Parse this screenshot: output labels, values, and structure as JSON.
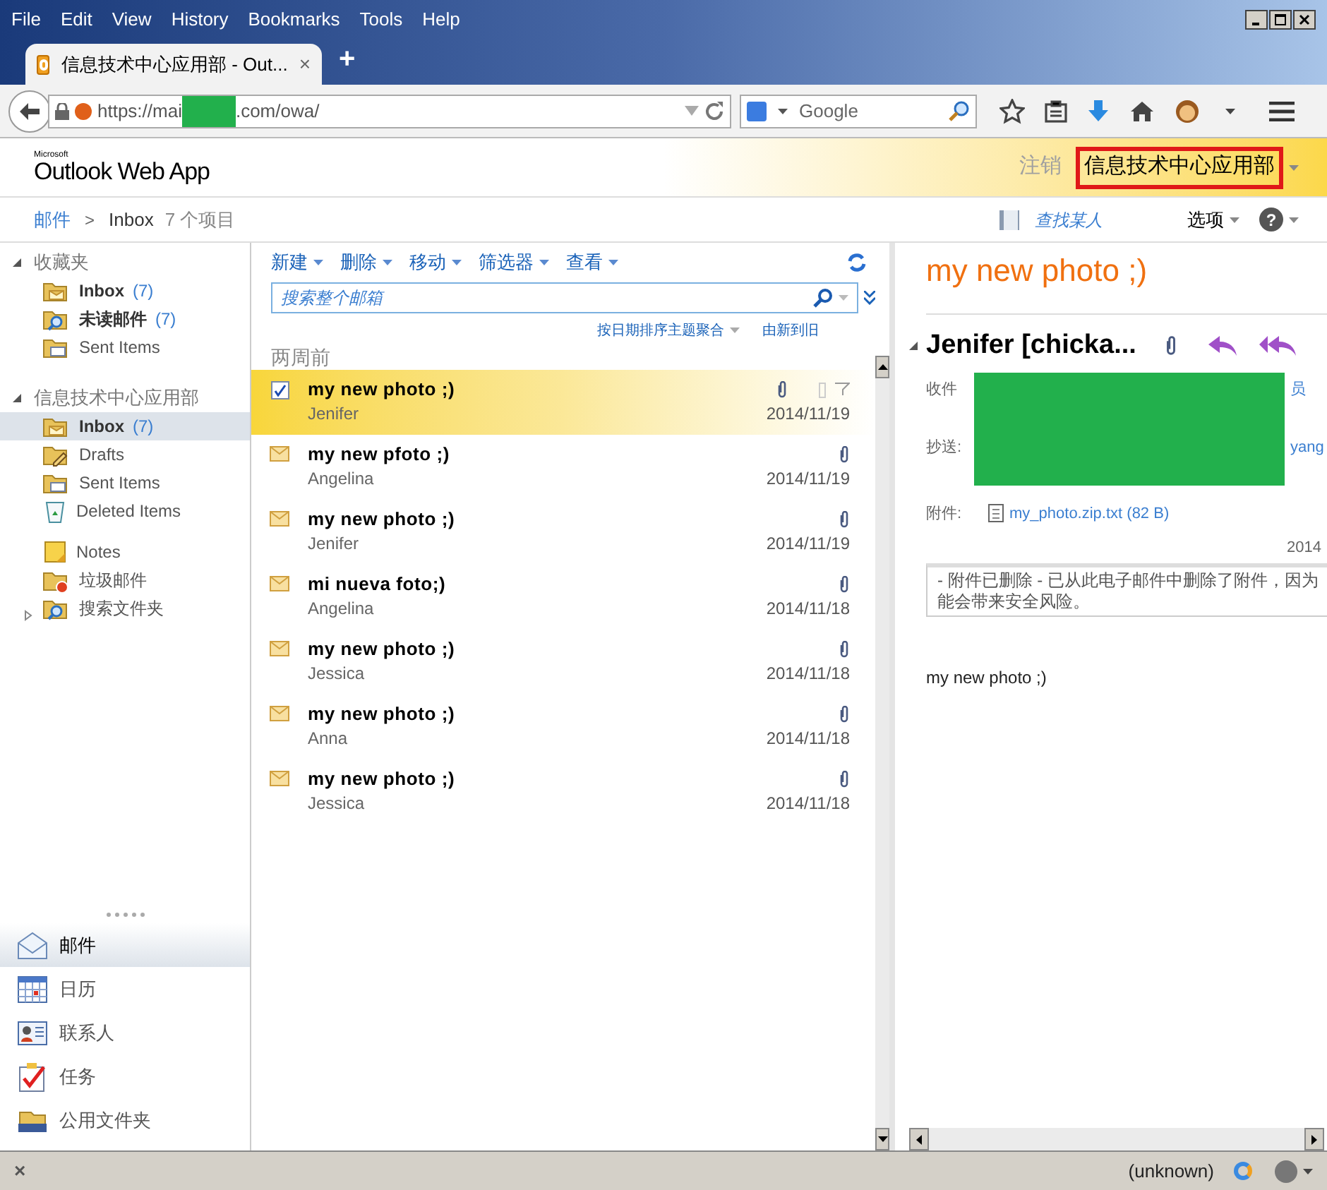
{
  "browser": {
    "menu": [
      "File",
      "Edit",
      "View",
      "History",
      "Bookmarks",
      "Tools",
      "Help"
    ],
    "tab": {
      "title": "信息技术中心应用部 - Out...",
      "close": "×"
    },
    "new_tab": "+",
    "url": {
      "prefix": "https://mai",
      "suffix": ".com/owa/"
    },
    "search": {
      "placeholder": "Google"
    }
  },
  "header": {
    "brand_small": "Microsoft",
    "brand": "Outlook Web App",
    "signout": "注销",
    "user": "信息技术中心应用部"
  },
  "breadcrumb": {
    "root": "邮件",
    "separator": ">",
    "folder": "Inbox",
    "count": "7 个项目",
    "find_someone": "查找某人",
    "options": "选项",
    "help": "?"
  },
  "sidebar": {
    "groups": [
      {
        "title": "收藏夹",
        "expanded": true,
        "items": [
          {
            "label": "Inbox",
            "count": "(7)",
            "kind": "inbox",
            "bold": true,
            "selected": false
          },
          {
            "label": "未读邮件",
            "count": "(7)",
            "kind": "search",
            "bold": true,
            "selected": false
          },
          {
            "label": "Sent Items",
            "kind": "sent",
            "bold": false,
            "selected": false
          }
        ]
      },
      {
        "title": "信息技术中心应用部",
        "expanded": true,
        "items": [
          {
            "label": "Inbox",
            "count": "(7)",
            "kind": "inbox",
            "bold": true,
            "selected": true
          },
          {
            "label": "Drafts",
            "kind": "drafts",
            "bold": false,
            "selected": false
          },
          {
            "label": "Sent Items",
            "kind": "sent",
            "bold": false,
            "selected": false
          },
          {
            "label": "Deleted Items",
            "kind": "deleted",
            "bold": false,
            "selected": false
          },
          {
            "label": "Notes",
            "kind": "notes",
            "bold": false,
            "selected": false,
            "gap": true
          },
          {
            "label": "垃圾邮件",
            "kind": "junk",
            "bold": false,
            "selected": false
          },
          {
            "label": "搜索文件夹",
            "kind": "search",
            "bold": false,
            "selected": false,
            "expanded": false
          }
        ]
      }
    ],
    "modules": [
      {
        "label": "邮件",
        "kind": "mail",
        "selected": true
      },
      {
        "label": "日历",
        "kind": "calendar",
        "selected": false
      },
      {
        "label": "联系人",
        "kind": "contacts",
        "selected": false
      },
      {
        "label": "任务",
        "kind": "tasks",
        "selected": false
      },
      {
        "label": "公用文件夹",
        "kind": "public",
        "selected": false
      }
    ]
  },
  "toolbar": [
    "新建",
    "删除",
    "移动",
    "筛选器",
    "查看"
  ],
  "search": {
    "placeholder": "搜索整个邮箱"
  },
  "sort": {
    "by": "按日期排序主题聚合",
    "order": "由新到旧"
  },
  "group": "两周前",
  "messages": [
    {
      "subject": "my new photo ;)",
      "sender": "Jenifer",
      "date": "2014/11/19",
      "selected": true
    },
    {
      "subject": "my new pfoto ;)",
      "sender": "Angelina",
      "date": "2014/11/19",
      "selected": false
    },
    {
      "subject": "my new photo ;)",
      "sender": "Jenifer",
      "date": "2014/11/19",
      "selected": false
    },
    {
      "subject": "mi nueva foto;)",
      "sender": "Angelina",
      "date": "2014/11/18",
      "selected": false
    },
    {
      "subject": "my new photo ;)",
      "sender": "Jessica",
      "date": "2014/11/18",
      "selected": false
    },
    {
      "subject": "my new photo ;)",
      "sender": "Anna",
      "date": "2014/11/18",
      "selected": false
    },
    {
      "subject": "my new photo ;)",
      "sender": "Jessica",
      "date": "2014/11/18",
      "selected": false
    }
  ],
  "reading": {
    "subject": "my new photo ;)",
    "from": "Jenifer [chicka...",
    "to_label": "收件",
    "to_visible": "员",
    "cc_label": "抄送:",
    "cc_visible": "yang",
    "attach_label": "附件:",
    "attachment": "my_photo.zip.txt (82 B)",
    "date": "2014",
    "notice": [
      "- 附件已删除 - 已从此电子邮件中删除了附件，因为",
      "能会带来安全风险。"
    ],
    "body": "my new photo ;)"
  },
  "status": {
    "text": "(unknown)",
    "close": "×"
  }
}
